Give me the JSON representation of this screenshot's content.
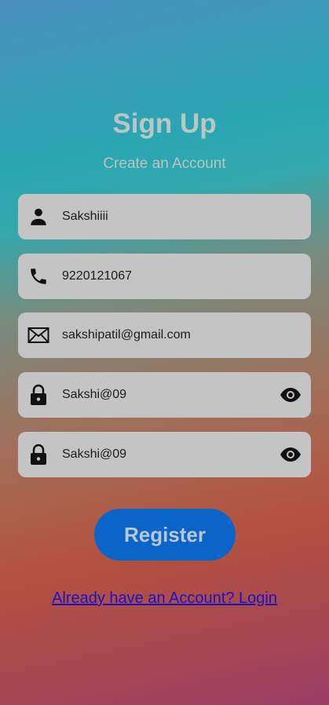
{
  "header": {
    "title": "Sign Up",
    "subtitle": "Create an Account"
  },
  "form": {
    "name_value": "Sakshiiii",
    "phone_value": "9220121067",
    "email_value": "sakshipatil@gmail.com",
    "password_value": "Sakshi@09",
    "confirm_password_value": "Sakshi@09"
  },
  "icons": {
    "name": "person-icon",
    "phone": "phone-icon",
    "email": "mail-icon",
    "password": "lock-icon",
    "visibility": "eye-icon"
  },
  "actions": {
    "register_label": "Register",
    "login_link": "Already have an Account? Login"
  },
  "colors": {
    "field_bg": "#c4c4c4",
    "button_bg": "#0b64c8",
    "link": "#1a12c9"
  }
}
